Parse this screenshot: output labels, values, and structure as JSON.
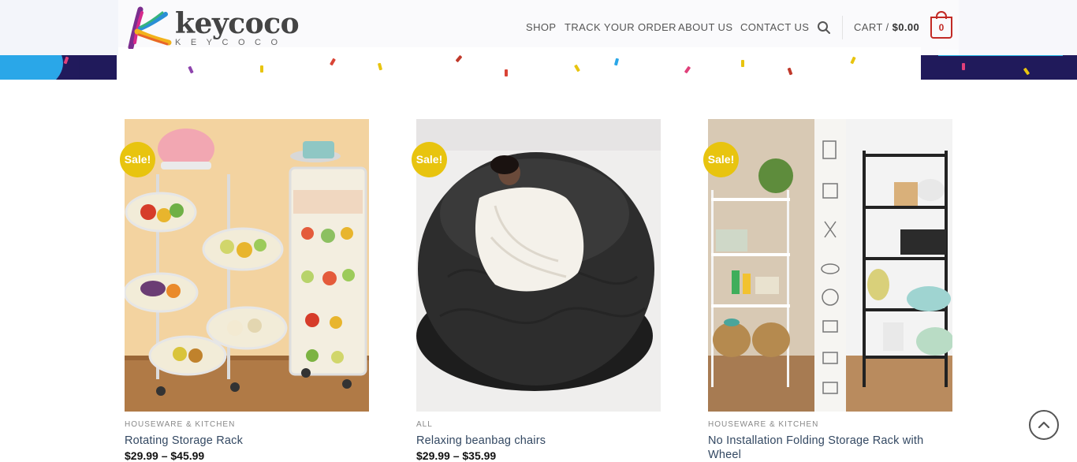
{
  "header": {
    "logo_word": "keycoco",
    "logo_sub": "KEYCOCO",
    "nav": [
      "SHOP",
      "TRACK YOUR ORDER",
      "ABOUT US",
      "CONTACT US"
    ],
    "cart_label": "CART /",
    "cart_amount": "$0.00",
    "cart_count": "0",
    "icons": {
      "search": "search-icon",
      "cart": "cart-bag-icon"
    }
  },
  "banner": {
    "slider_dots": 1,
    "active_dot": 1
  },
  "products": [
    {
      "badge": "Sale!",
      "category": "HOUSEWARE & KITCHEN",
      "title": "Rotating Storage Rack",
      "price_text": "$29.99 – $45.99"
    },
    {
      "badge": "Sale!",
      "category": "ALL",
      "title": "Relaxing beanbag chairs",
      "price_text": "$29.99 – $35.99"
    },
    {
      "badge": "Sale!",
      "category": "HOUSEWARE & KITCHEN",
      "title": "No Installation Folding Storage Rack with Wheel",
      "price_text": ""
    }
  ],
  "colors": {
    "accent_red": "#c22a25",
    "sale_yellow": "#e8c40f",
    "banner_navy": "#211a5c",
    "link_blue": "#334862"
  },
  "back_to_top": "chevron-up-icon"
}
